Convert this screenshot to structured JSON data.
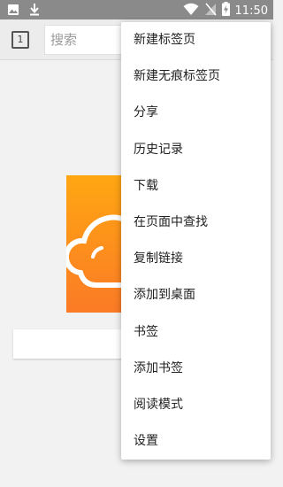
{
  "status_bar": {
    "time": "11:50",
    "icons": [
      "image-icon",
      "download-icon",
      "wifi-icon",
      "no-sim-icon",
      "battery-charging-icon"
    ]
  },
  "toolbar": {
    "tab_count": "1",
    "search_placeholder": "搜索"
  },
  "menu": {
    "items": [
      {
        "label": "新建标签页"
      },
      {
        "label": "新建无痕标签页"
      },
      {
        "label": "分享"
      },
      {
        "label": "历史记录"
      },
      {
        "label": "下载"
      },
      {
        "label": "在页面中查找"
      },
      {
        "label": "复制链接"
      },
      {
        "label": "添加到桌面"
      },
      {
        "label": "书签"
      },
      {
        "label": "添加书签"
      },
      {
        "label": "阅读模式"
      },
      {
        "label": "设置"
      }
    ]
  },
  "colors": {
    "status_bar": "#8a8a8a",
    "toolbar": "#ececec",
    "logo_top": "#ffa712",
    "logo_bottom": "#fb7a26",
    "menu_bg": "#ffffff"
  }
}
